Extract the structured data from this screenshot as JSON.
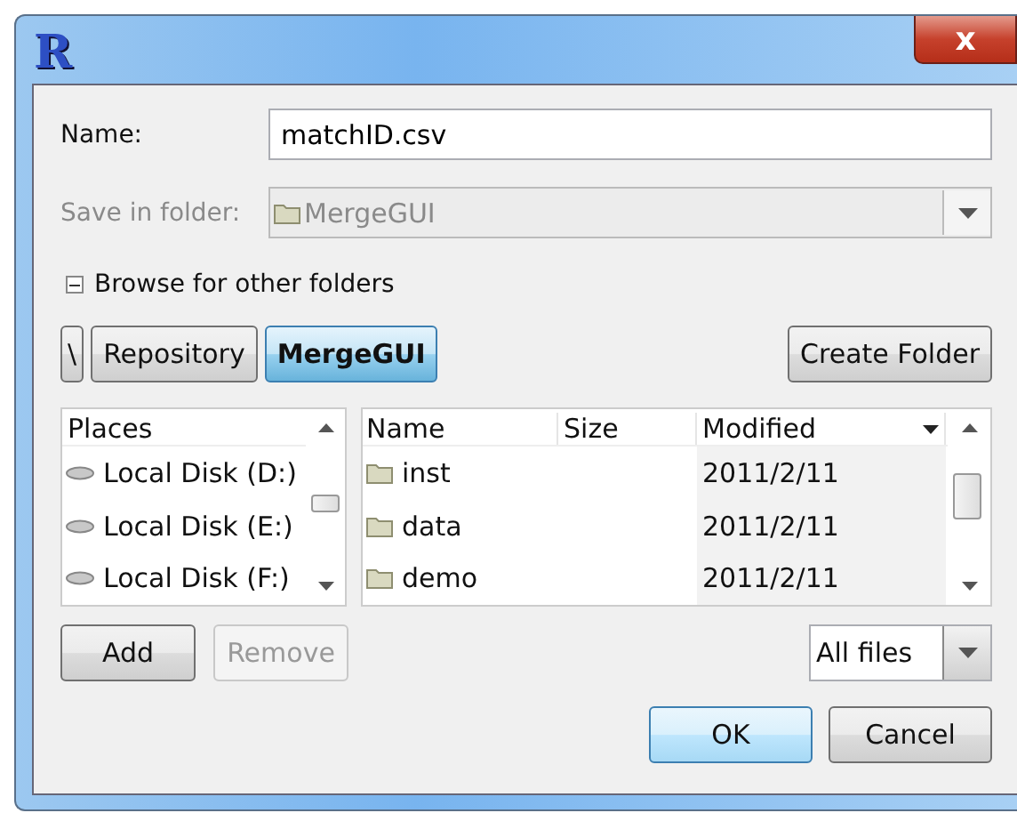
{
  "window": {
    "title_icon": "R",
    "close": "x"
  },
  "name_field": {
    "label": "Name:",
    "value": "matchID.csv"
  },
  "folder_field": {
    "label": "Save in folder:",
    "value": "MergeGUI",
    "disabled": true
  },
  "browse": {
    "label": "Browse for other folders",
    "expanded": true
  },
  "path_buttons": [
    {
      "label": "\\",
      "selected": false
    },
    {
      "label": "Repository",
      "selected": false
    },
    {
      "label": "MergeGUI",
      "selected": true
    }
  ],
  "create_folder": "Create Folder",
  "places": {
    "header": "Places",
    "items": [
      {
        "label": "Local Disk (D:)"
      },
      {
        "label": "Local Disk (E:)"
      },
      {
        "label": "Local Disk (F:)"
      }
    ]
  },
  "files": {
    "columns": [
      "Name",
      "Size",
      "Modified"
    ],
    "rows": [
      {
        "name": "inst",
        "size": "",
        "modified": "2011/2/11"
      },
      {
        "name": "data",
        "size": "",
        "modified": "2011/2/11"
      },
      {
        "name": "demo",
        "size": "",
        "modified": "2011/2/11"
      }
    ]
  },
  "list_buttons": [
    {
      "label": "Add",
      "disabled": false
    },
    {
      "label": "Remove",
      "disabled": true
    }
  ],
  "filter": {
    "value": "All files"
  },
  "buttons": [
    {
      "label": "OK",
      "default": true
    },
    {
      "label": "Cancel",
      "default": false
    }
  ]
}
